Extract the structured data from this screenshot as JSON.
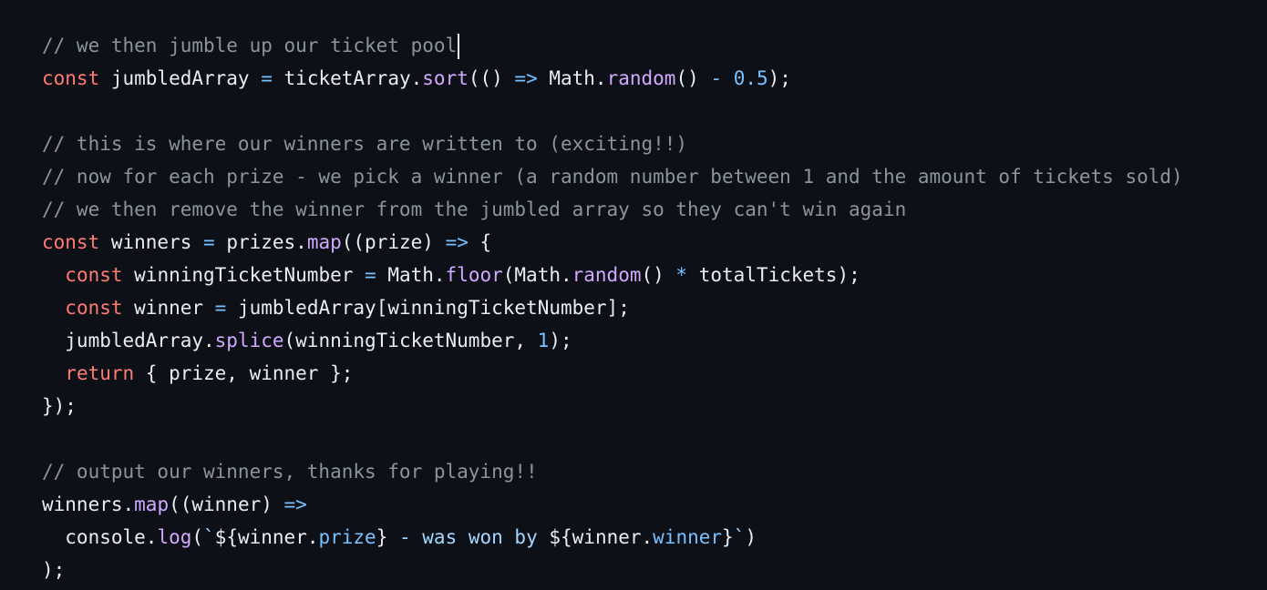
{
  "code": {
    "language": "javascript",
    "lines": [
      [
        {
          "t": "cm",
          "v": "// we then jumble up our ticket pool"
        }
      ],
      [
        {
          "t": "kw",
          "v": "const"
        },
        {
          "t": "plain",
          "v": " jumbledArray "
        },
        {
          "t": "op",
          "v": "="
        },
        {
          "t": "plain",
          "v": " ticketArray."
        },
        {
          "t": "fn",
          "v": "sort"
        },
        {
          "t": "plain",
          "v": "(() "
        },
        {
          "t": "op",
          "v": "=>"
        },
        {
          "t": "plain",
          "v": " Math."
        },
        {
          "t": "fn",
          "v": "random"
        },
        {
          "t": "plain",
          "v": "() "
        },
        {
          "t": "op",
          "v": "-"
        },
        {
          "t": "plain",
          "v": " "
        },
        {
          "t": "num",
          "v": "0.5"
        },
        {
          "t": "plain",
          "v": ");"
        }
      ],
      [],
      [
        {
          "t": "cm",
          "v": "// this is where our winners are written to (exciting!!)"
        }
      ],
      [
        {
          "t": "cm",
          "v": "// now for each prize - we pick a winner (a random number between 1 and the amount of tickets sold)"
        }
      ],
      [
        {
          "t": "cm",
          "v": "// we then remove the winner from the jumbled array so they can't win again"
        }
      ],
      [
        {
          "t": "kw",
          "v": "const"
        },
        {
          "t": "plain",
          "v": " winners "
        },
        {
          "t": "op",
          "v": "="
        },
        {
          "t": "plain",
          "v": " prizes."
        },
        {
          "t": "fn",
          "v": "map"
        },
        {
          "t": "plain",
          "v": "((prize) "
        },
        {
          "t": "op",
          "v": "=>"
        },
        {
          "t": "plain",
          "v": " {"
        }
      ],
      [
        {
          "t": "plain",
          "v": "  "
        },
        {
          "t": "kw",
          "v": "const"
        },
        {
          "t": "plain",
          "v": " winningTicketNumber "
        },
        {
          "t": "op",
          "v": "="
        },
        {
          "t": "plain",
          "v": " Math."
        },
        {
          "t": "fn",
          "v": "floor"
        },
        {
          "t": "plain",
          "v": "(Math."
        },
        {
          "t": "fn",
          "v": "random"
        },
        {
          "t": "plain",
          "v": "() "
        },
        {
          "t": "op",
          "v": "*"
        },
        {
          "t": "plain",
          "v": " totalTickets);"
        }
      ],
      [
        {
          "t": "plain",
          "v": "  "
        },
        {
          "t": "kw",
          "v": "const"
        },
        {
          "t": "plain",
          "v": " winner "
        },
        {
          "t": "op",
          "v": "="
        },
        {
          "t": "plain",
          "v": " jumbledArray[winningTicketNumber];"
        }
      ],
      [
        {
          "t": "plain",
          "v": "  jumbledArray."
        },
        {
          "t": "fn",
          "v": "splice"
        },
        {
          "t": "plain",
          "v": "(winningTicketNumber, "
        },
        {
          "t": "num",
          "v": "1"
        },
        {
          "t": "plain",
          "v": ");"
        }
      ],
      [
        {
          "t": "plain",
          "v": "  "
        },
        {
          "t": "kw",
          "v": "return"
        },
        {
          "t": "plain",
          "v": " { prize, winner };"
        }
      ],
      [
        {
          "t": "plain",
          "v": "});"
        }
      ],
      [],
      [
        {
          "t": "cm",
          "v": "// output our winners, thanks for playing!!"
        }
      ],
      [
        {
          "t": "plain",
          "v": "winners."
        },
        {
          "t": "fn",
          "v": "map"
        },
        {
          "t": "plain",
          "v": "((winner) "
        },
        {
          "t": "op",
          "v": "=>"
        }
      ],
      [
        {
          "t": "plain",
          "v": "  console."
        },
        {
          "t": "fn",
          "v": "log"
        },
        {
          "t": "plain",
          "v": "("
        },
        {
          "t": "str",
          "v": "`"
        },
        {
          "t": "plain",
          "v": "${winner."
        },
        {
          "t": "prop",
          "v": "prize"
        },
        {
          "t": "plain",
          "v": "}"
        },
        {
          "t": "str",
          "v": " - was won by "
        },
        {
          "t": "plain",
          "v": "${winner."
        },
        {
          "t": "prop",
          "v": "winner"
        },
        {
          "t": "plain",
          "v": "}"
        },
        {
          "t": "str",
          "v": "`"
        },
        {
          "t": "plain",
          "v": ")"
        }
      ],
      [
        {
          "t": "plain",
          "v": ");"
        }
      ]
    ],
    "caret_line": 0
  },
  "colors": {
    "background": "#0d1117",
    "text": "#e6edf3",
    "comment": "#8b949e",
    "keyword": "#ff7b72",
    "function": "#d2a8ff",
    "operator": "#79c0ff",
    "number": "#79c0ff",
    "string": "#a5d6ff"
  }
}
